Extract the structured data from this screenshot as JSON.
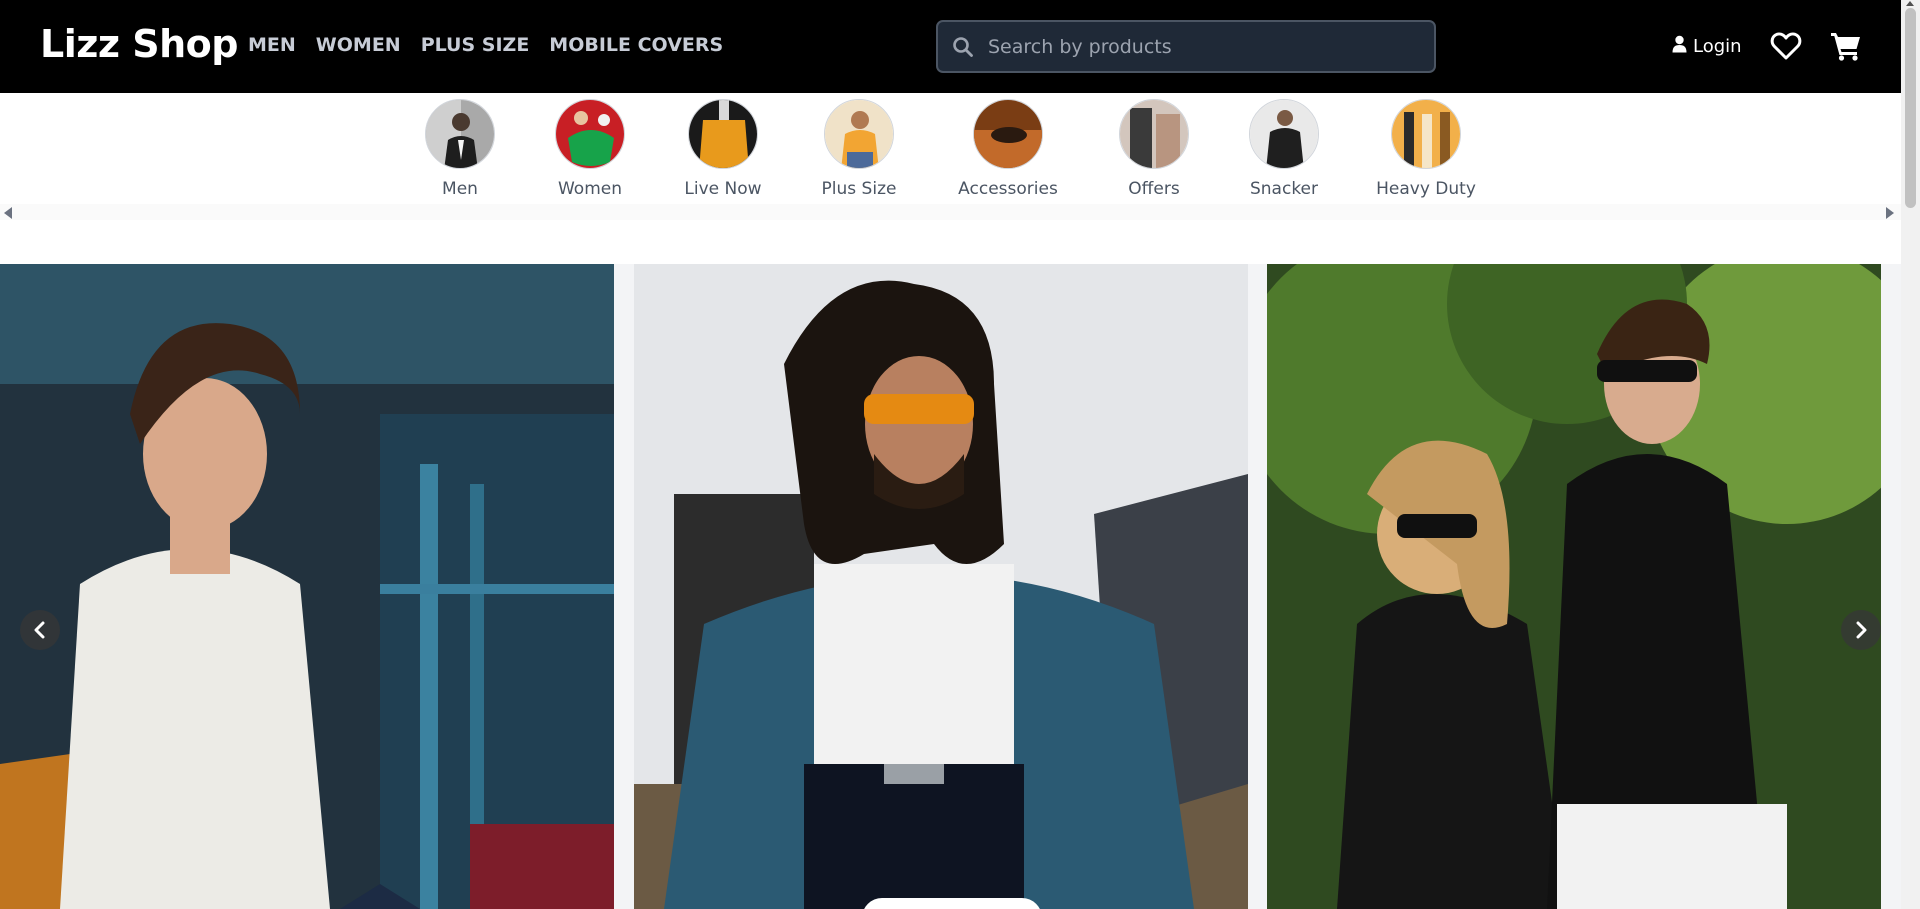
{
  "brand": {
    "name": "Lizz Shop"
  },
  "nav": {
    "items": [
      "MEN",
      "WOMEN",
      "PLUS SIZE",
      "MOBILE COVERS"
    ]
  },
  "search": {
    "placeholder": "Search by products",
    "value": ""
  },
  "account": {
    "login_label": "Login"
  },
  "icons": {
    "search": "search-icon",
    "user": "user-icon",
    "wishlist": "heart-icon",
    "cart": "cart-icon",
    "prev": "chevron-left-icon",
    "next": "chevron-right-icon"
  },
  "categories": [
    {
      "label": "Men"
    },
    {
      "label": "Women"
    },
    {
      "label": "Live Now"
    },
    {
      "label": "Plus Size"
    },
    {
      "label": "Accessories"
    },
    {
      "label": "Offers"
    },
    {
      "label": "Snacker"
    },
    {
      "label": "Heavy Duty"
    }
  ],
  "hero": {
    "slides": [
      {
        "alt": "Man in white polo shirt seated outdoors"
      },
      {
        "alt": "Man in teal leather jacket with orange sunglasses"
      },
      {
        "alt": "Couple in sunglasses in a garden"
      }
    ]
  },
  "colors": {
    "header_bg": "#000000",
    "nav_text": "#c7ccd6",
    "search_bg": "#1f2937",
    "category_label": "#4b5563"
  }
}
